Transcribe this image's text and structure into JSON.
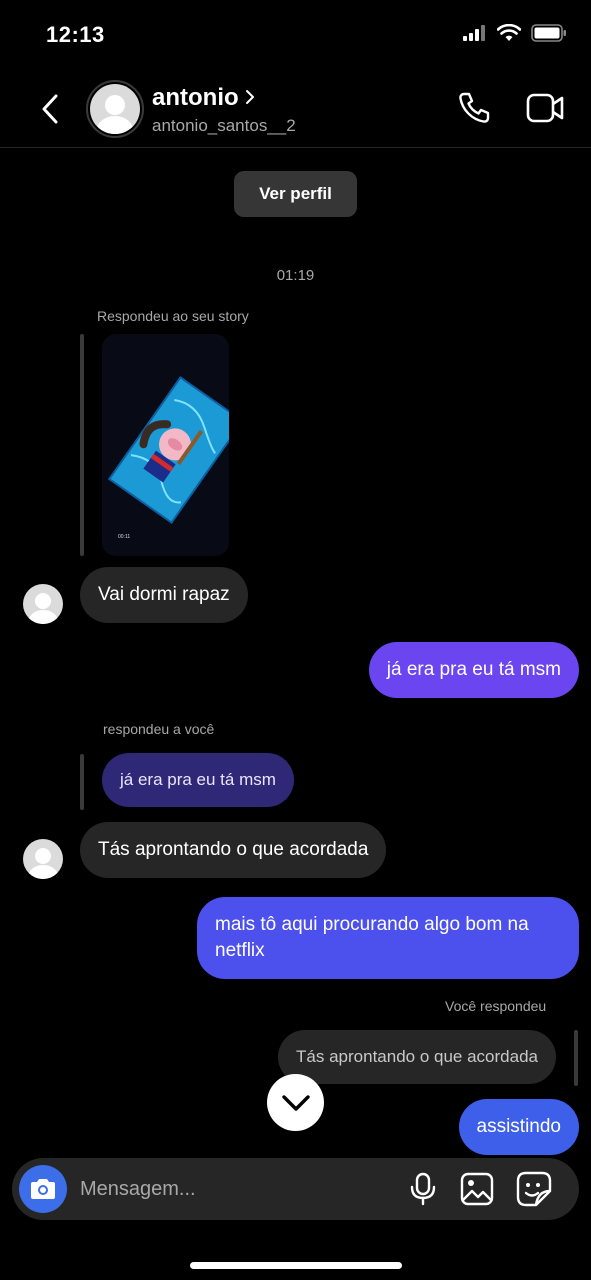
{
  "status_bar": {
    "time": "12:13"
  },
  "header": {
    "name": "antonio",
    "username": "antonio_santos__2"
  },
  "profile_button": "Ver perfil",
  "timestamp": "01:19",
  "messages": {
    "story_reply_label": "Respondeu ao seu story",
    "incoming_1": "Vai dormi rapaz",
    "outgoing_1": "já era pra eu tá msm",
    "reply_label": "respondeu a você",
    "reply_quote": "já era pra eu tá msm",
    "incoming_2": "Tás aprontando o que acordada",
    "outgoing_2": "mais tô aqui procurando algo bom na netflix",
    "my_reply_label": "Você respondeu",
    "my_reply_quote": "Tás aprontando o que acordada",
    "outgoing_3": "assistindo"
  },
  "story_thumb": {
    "time_text": "00:11"
  },
  "composer": {
    "placeholder": "Mensagem..."
  },
  "colors": {
    "outgoing_gradient": [
      "#6a45f0",
      "#4c50ec",
      "#3d5fea"
    ],
    "camera_button": "#3b6ee8"
  }
}
